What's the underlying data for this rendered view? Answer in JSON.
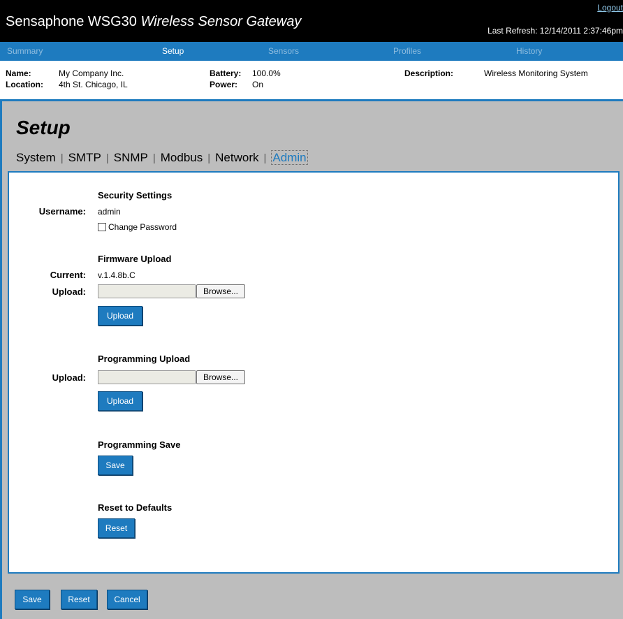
{
  "header": {
    "title_main": "Sensaphone WSG30 ",
    "title_italic": "Wireless Sensor Gateway",
    "logout": "Logout",
    "last_refresh": "Last Refresh: 12/14/2011 2:37:46pm"
  },
  "nav": {
    "items": [
      "Summary",
      "Setup",
      "Sensors",
      "Profiles",
      "History"
    ],
    "active": "Setup"
  },
  "info": {
    "name_label": "Name:",
    "name_value": "My Company Inc.",
    "location_label": "Location:",
    "location_value": "4th St. Chicago, IL",
    "battery_label": "Battery:",
    "battery_value": "100.0%",
    "power_label": "Power:",
    "power_value": "On",
    "description_label": "Description:",
    "description_value": "Wireless Monitoring System"
  },
  "page": {
    "title": "Setup",
    "tabs": [
      "System",
      "SMTP",
      "SNMP",
      "Modbus",
      "Network",
      "Admin"
    ],
    "tab_separator": "|",
    "active_tab": "Admin"
  },
  "security": {
    "heading": "Security Settings",
    "username_label": "Username:",
    "username_value": "admin",
    "change_password_label": "Change Password",
    "change_password_checked": false
  },
  "firmware": {
    "heading": "Firmware Upload",
    "current_label": "Current:",
    "current_value": "v.1.4.8b.C",
    "upload_label": "Upload:",
    "browse_label": "Browse...",
    "upload_button": "Upload"
  },
  "programming_upload": {
    "heading": "Programming Upload",
    "upload_label": "Upload:",
    "browse_label": "Browse...",
    "upload_button": "Upload"
  },
  "programming_save": {
    "heading": "Programming Save",
    "save_button": "Save"
  },
  "reset_defaults": {
    "heading": "Reset to Defaults",
    "reset_button": "Reset"
  },
  "footer": {
    "save": "Save",
    "reset": "Reset",
    "cancel": "Cancel"
  },
  "colors": {
    "accent": "#1e7bbf",
    "header_bg": "#000000",
    "panel_bg": "#bdbdbd"
  }
}
